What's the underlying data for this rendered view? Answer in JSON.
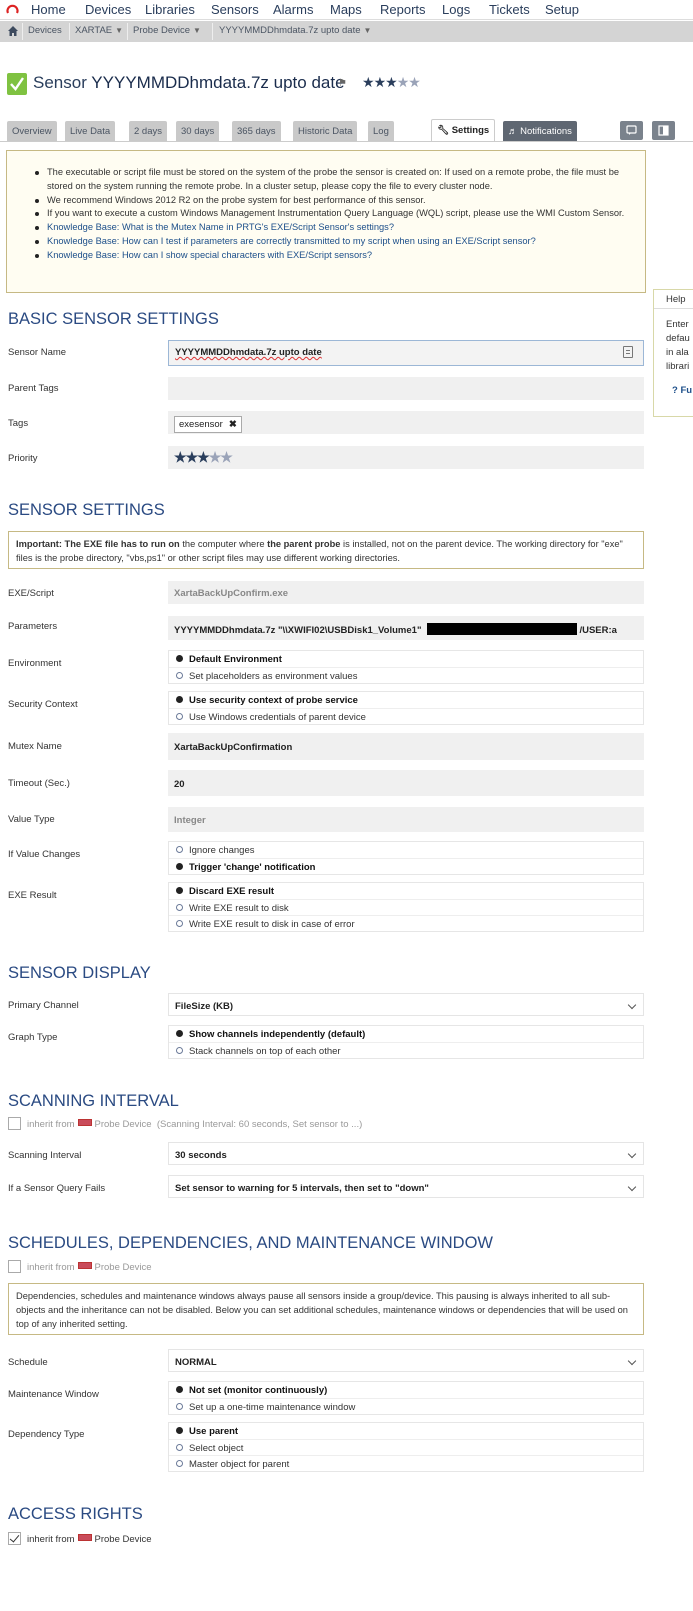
{
  "topnav": {
    "items": [
      "Home",
      "Devices",
      "Libraries",
      "Sensors",
      "Alarms",
      "Maps",
      "Reports",
      "Logs",
      "Tickets",
      "Setup"
    ]
  },
  "breadcrumb": {
    "items": [
      "Devices",
      "XARTAE",
      "Probe Device",
      "YYYYMMDDhmdata.7z upto date"
    ]
  },
  "page": {
    "title_prefix": "Sensor",
    "title_name": "YYYYMMDDhmdata.7z upto date",
    "priority_stars": 3,
    "priority_max": 5
  },
  "tabs": {
    "items": [
      "Overview",
      "Live Data",
      "2 days",
      "30 days",
      "365 days",
      "Historic Data",
      "Log",
      "Settings",
      "Notifications"
    ],
    "active": "Settings"
  },
  "notes": {
    "items": [
      "The executable or script file must be stored on the system of the probe the sensor is created on: If used on a remote probe, the file must be stored on the system running the remote probe. In a cluster setup, please copy the file to every cluster node.",
      "We recommend Windows 2012 R2 on the probe system for best performance of this sensor.",
      "If you want to execute a custom Windows Management Instrumentation Query Language (WQL) script, please use the WMI Custom Sensor.",
      "Knowledge Base: What is the Mutex Name in PRTG's EXE/Script Sensor's settings?",
      "Knowledge Base: How can I test if parameters are correctly transmitted to my script when using an EXE/Script sensor?",
      "Knowledge Base: How can I show special characters with EXE/Script sensors?"
    ]
  },
  "help": {
    "title": "Help",
    "lines": [
      "Enter",
      "defau",
      "in ala",
      "librari"
    ],
    "link": "? Fu"
  },
  "basic": {
    "heading": "BASIC SENSOR SETTINGS",
    "sensor_name_label": "Sensor Name",
    "sensor_name_value": "YYYYMMDDhmdata.7z upto date",
    "parent_tags_label": "Parent Tags",
    "parent_tags_value": "",
    "tags_label": "Tags",
    "tag_value": "exesensor",
    "priority_label": "Priority"
  },
  "sensor": {
    "heading": "SENSOR SETTINGS",
    "important": {
      "p1": "Important: The EXE file has to run on",
      "p2": " the computer where ",
      "p3": "the parent probe",
      "p4": " is installed, not on the parent device. The working directory for \"exe\" files is the probe directory, \"vbs,ps1\" or other script files may use different working directories."
    },
    "exe_label": "EXE/Script",
    "exe_value": "XartaBackUpConfirm.exe",
    "params_label": "Parameters",
    "params_value": "YYYYMMDDhmdata.7z \"\\\\XWIFI02\\USBDisk1_Volume1\"",
    "params_tail": "/USER:a",
    "env_label": "Environment",
    "env_options": [
      "Default Environment",
      "Set placeholders as environment values"
    ],
    "sec_label": "Security Context",
    "sec_options": [
      "Use security context of probe service",
      "Use Windows credentials of parent device"
    ],
    "mutex_label": "Mutex Name",
    "mutex_value": "XartaBackUpConfirmation",
    "timeout_label": "Timeout (Sec.)",
    "timeout_value": "20",
    "valuetype_label": "Value Type",
    "valuetype_value": "Integer",
    "change_label": "If Value Changes",
    "change_options": [
      "Ignore changes",
      "Trigger 'change' notification"
    ],
    "exeresult_label": "EXE Result",
    "exeresult_options": [
      "Discard EXE result",
      "Write EXE result to disk",
      "Write EXE result to disk in case of error"
    ]
  },
  "display": {
    "heading": "SENSOR DISPLAY",
    "primary_label": "Primary Channel",
    "primary_value": "FileSize (KB)",
    "graph_label": "Graph Type",
    "graph_options": [
      "Show channels independently (default)",
      "Stack channels on top of each other"
    ]
  },
  "scanning": {
    "heading": "SCANNING INTERVAL",
    "inherit_text": "inherit from",
    "inherit_device": "Probe Device",
    "inherit_note": "(Scanning Interval: 60 seconds, Set sensor to ...)",
    "interval_label": "Scanning Interval",
    "interval_value": "30 seconds",
    "fails_label": "If a Sensor Query Fails",
    "fails_value": "Set sensor to warning for 5 intervals, then set to \"down\""
  },
  "schedules": {
    "heading": "SCHEDULES, DEPENDENCIES, AND MAINTENANCE WINDOW",
    "inherit_text": "inherit from",
    "inherit_device": "Probe Device",
    "note": "Dependencies, schedules and maintenance windows always pause all sensors inside a group/device. This pausing is always inherited to all sub-objects and the inheritance can not be disabled. Below you can set additional schedules, maintenance windows or dependencies that will be used on top of any inherited setting.",
    "schedule_label": "Schedule",
    "schedule_value": "NORMAL",
    "maint_label": "Maintenance Window",
    "maint_options": [
      "Not set (monitor continuously)",
      "Set up a one-time maintenance window"
    ],
    "dep_label": "Dependency Type",
    "dep_options": [
      "Use parent",
      "Select object",
      "Master object for parent"
    ]
  },
  "access": {
    "heading": "ACCESS RIGHTS",
    "inherit_text": "inherit from",
    "inherit_device": "Probe Device"
  }
}
